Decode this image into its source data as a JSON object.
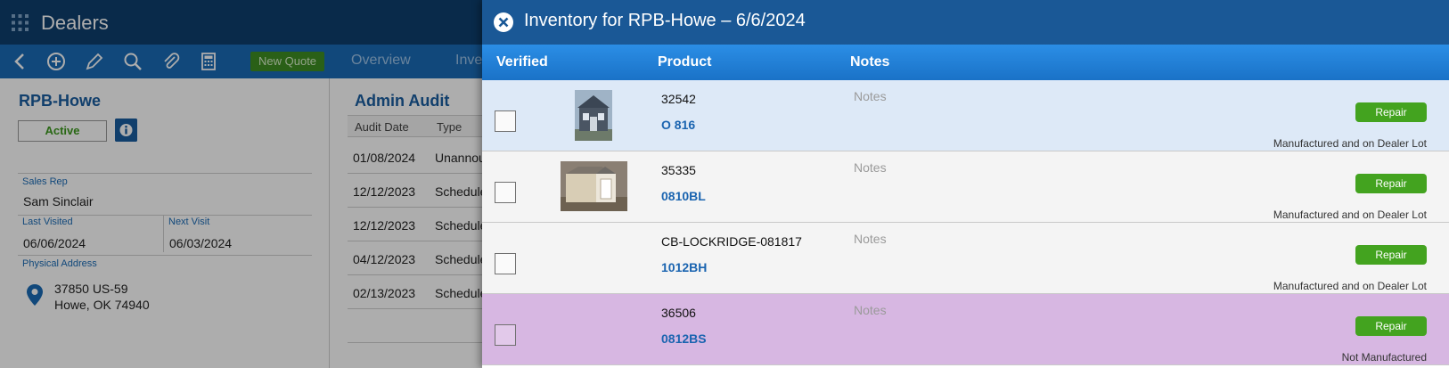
{
  "app": {
    "title": "Dealers",
    "toolbar": {
      "new_quote_label": "New Quote",
      "tabs": [
        "Overview",
        "Inve"
      ]
    }
  },
  "dealer": {
    "name": "RPB-Howe",
    "status": "Active",
    "sales_rep_label": "Sales Rep",
    "sales_rep": "Sam Sinclair",
    "last_visited_label": "Last Visited",
    "last_visited": "06/06/2024",
    "next_visit_label": "Next Visit",
    "next_visit": "06/03/2024",
    "address_label": "Physical Address",
    "address_line1": "37850 US-59",
    "address_line2": "Howe, OK 74940"
  },
  "audit": {
    "title": "Admin Audit",
    "columns": [
      "Audit Date",
      "Type"
    ],
    "rows": [
      {
        "date": "01/08/2024",
        "type": "Unannou"
      },
      {
        "date": "12/12/2023",
        "type": "Schedule"
      },
      {
        "date": "12/12/2023",
        "type": "Schedule"
      },
      {
        "date": "04/12/2023",
        "type": "Schedule"
      },
      {
        "date": "02/13/2023",
        "type": "Schedule"
      }
    ]
  },
  "inventory": {
    "title": "Inventory for RPB-Howe – 6/6/2024",
    "columns": {
      "verified": "Verified",
      "product": "Product",
      "notes": "Notes"
    },
    "rows": [
      {
        "serial": "32542",
        "model": "O 816",
        "notes_placeholder": "Notes",
        "repair_label": "Repair",
        "status": "Manufactured and on Dealer Lot",
        "bg": "#dde9f7",
        "thumb": "dark-building"
      },
      {
        "serial": "35335",
        "model": "0810BL",
        "notes_placeholder": "Notes",
        "repair_label": "Repair",
        "status": "Manufactured and on Dealer Lot",
        "bg": "#f4f4f4",
        "thumb": "tan-barn"
      },
      {
        "serial": "CB-LOCKRIDGE-081817",
        "model": "1012BH",
        "notes_placeholder": "Notes",
        "repair_label": "Repair",
        "status": "Manufactured and on Dealer Lot",
        "bg": "#f4f4f4",
        "thumb": ""
      },
      {
        "serial": "36506",
        "model": "0812BS",
        "notes_placeholder": "Notes",
        "repair_label": "Repair",
        "status": "Not Manufactured",
        "bg": "#d7b7e2",
        "thumb": ""
      }
    ]
  },
  "colors": {
    "header": "#0e3f6e",
    "toolbar": "#1a6bb5",
    "panel_header": "#1a5896",
    "repair_green": "#43a31f",
    "model_blue": "#1a64b0"
  }
}
